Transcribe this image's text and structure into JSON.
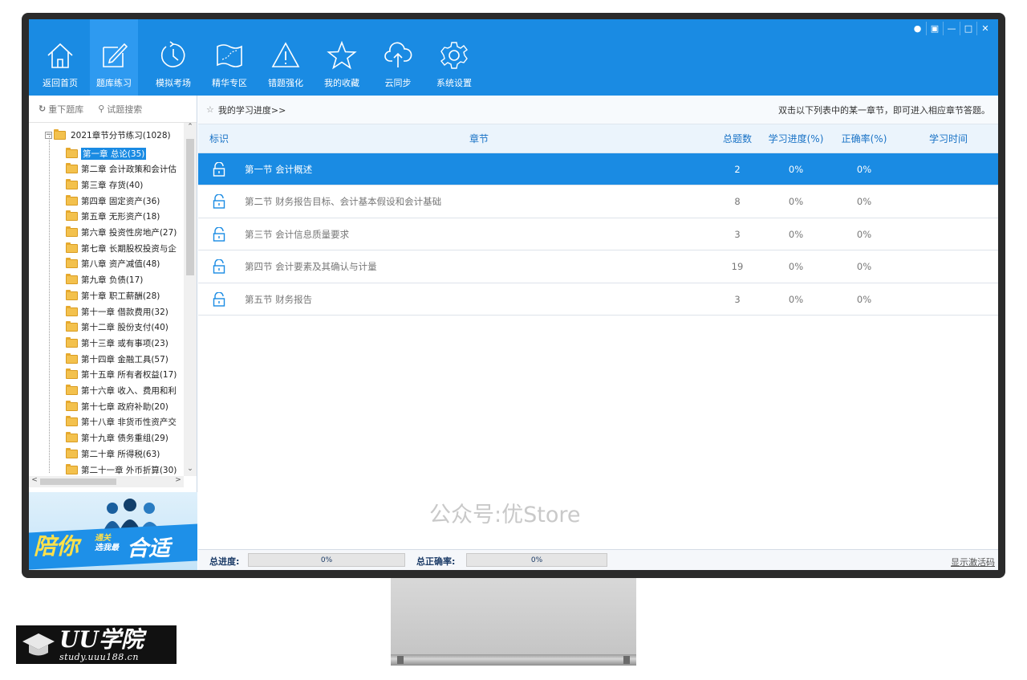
{
  "toolbar": {
    "tools": [
      {
        "label": "返回首页",
        "icon": "home-icon"
      },
      {
        "label": "题库练习",
        "icon": "edit-icon"
      },
      {
        "label": "模拟考场",
        "icon": "clock-icon"
      },
      {
        "label": "精华专区",
        "icon": "map-icon"
      },
      {
        "label": "错题强化",
        "icon": "warning-icon"
      },
      {
        "label": "我的收藏",
        "icon": "star-icon"
      },
      {
        "label": "云同步",
        "icon": "cloud-upload-icon"
      },
      {
        "label": "系统设置",
        "icon": "gear-icon"
      }
    ],
    "window_controls": [
      "user-icon",
      "menu-icon",
      "minimize-icon",
      "maximize-icon",
      "close-icon"
    ],
    "accent": "#1a8be3"
  },
  "left": {
    "reload_label": "重下题库",
    "search_label": "试题搜索",
    "root_label": "2021章节分节练习(1028)",
    "chapters": [
      "第一章  总论(35)",
      "第二章  会计政策和会计估",
      "第三章  存货(40)",
      "第四章 固定资产(36)",
      "第五章 无形资产(18)",
      "第六章  投资性房地产(27)",
      "第七章  长期股权投资与企",
      "第八章 资产减值(48)",
      "第九章  负债(17)",
      "第十章 职工薪酬(28)",
      "第十一章 借款费用(32)",
      "第十二章 股份支付(40)",
      "第十三章 或有事项(23)",
      "第十四章 金融工具(57)",
      "第十五章 所有者权益(17)",
      "第十六章  收入、费用和利",
      "第十七章 政府补助(20)",
      "第十八章  非货币性资产交",
      "第十九章 债务重组(29)",
      "第二十章 所得税(63)",
      "第二十一章  外币折算(30)"
    ],
    "banner": {
      "line1": "陪你",
      "line2a": "通关",
      "line2b": "选我最",
      "line3": "合适"
    }
  },
  "main": {
    "crumb_left": "我的学习进度>>",
    "crumb_right": "双击以下列表中的某一章节，即可进入相应章节答题。",
    "headers": {
      "mark": "标识",
      "section": "章节",
      "total": "总题数",
      "progress": "学习进度(%)",
      "accuracy": "正确率(%)",
      "time": "学习时间"
    },
    "rows": [
      {
        "section": "第一节 会计概述",
        "total": "2",
        "progress": "0%",
        "accuracy": "0%",
        "time": ""
      },
      {
        "section": "第二节 财务报告目标、会计基本假设和会计基础",
        "total": "8",
        "progress": "0%",
        "accuracy": "0%",
        "time": ""
      },
      {
        "section": "第三节 会计信息质量要求",
        "total": "3",
        "progress": "0%",
        "accuracy": "0%",
        "time": ""
      },
      {
        "section": "第四节 会计要素及其确认与计量",
        "total": "19",
        "progress": "0%",
        "accuracy": "0%",
        "time": ""
      },
      {
        "section": "第五节 财务报告",
        "total": "3",
        "progress": "0%",
        "accuracy": "0%",
        "time": ""
      }
    ],
    "watermark": "公众号:优Store",
    "status": {
      "total_progress_label": "总进度:",
      "total_progress_value": "0%",
      "total_accuracy_label": "总正确率:",
      "total_accuracy_value": "0%",
      "activation_link": "显示激活码"
    }
  },
  "badge": {
    "brand": "UU学院",
    "sub": "study.uuu188.cn"
  }
}
